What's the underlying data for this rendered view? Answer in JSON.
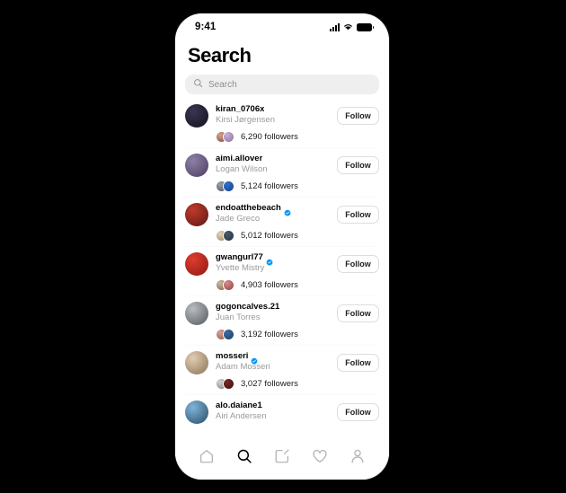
{
  "app": {
    "platform": "ios-instagram",
    "accent_verified": "#0095f6",
    "search_field_bg": "#efefef",
    "muted_text": "#9a9a9a"
  },
  "status_bar": {
    "time": "9:41",
    "icons": [
      "cellular-signal-icon",
      "wifi-icon",
      "battery-icon"
    ]
  },
  "header": {
    "title": "Search"
  },
  "search": {
    "icon": "search-icon",
    "value": "",
    "placeholder": "Search"
  },
  "results": [
    {
      "username": "kiran_0706x",
      "fullname": "Kirsi Jørgensen",
      "verified": false,
      "followers": "6,290 followers",
      "follow_label": "Follow",
      "avatar_colors": [
        "#3a3550",
        "#15121f"
      ],
      "mutual_colors": [
        [
          "#d9a28f",
          "#7a4a3a"
        ],
        [
          "#c8b2d6",
          "#8c6fa0"
        ]
      ]
    },
    {
      "username": "aimi.allover",
      "fullname": "Logan Wilson",
      "verified": false,
      "followers": "5,124 followers",
      "follow_label": "Follow",
      "avatar_colors": [
        "#8e7fa8",
        "#4a3f5c"
      ],
      "mutual_colors": [
        [
          "#9aa0a6",
          "#4e545a"
        ],
        [
          "#2f6fd0",
          "#17407f"
        ]
      ]
    },
    {
      "username": "endoatthebeach",
      "fullname": "Jade Greco",
      "verified": true,
      "followers": "5,012 followers",
      "follow_label": "Follow",
      "avatar_colors": [
        "#c0392b",
        "#5a1a14"
      ],
      "mutual_colors": [
        [
          "#e3d2b8",
          "#9c8560"
        ],
        [
          "#4a5a6a",
          "#243240"
        ]
      ]
    },
    {
      "username": "gwangurl77",
      "fullname": "Yvette Mistry",
      "verified": true,
      "followers": "4,903 followers",
      "follow_label": "Follow",
      "avatar_colors": [
        "#e03b2f",
        "#8c1a12"
      ],
      "mutual_colors": [
        [
          "#cdb79e",
          "#7a6450"
        ],
        [
          "#d98a8a",
          "#8f3f3f"
        ]
      ]
    },
    {
      "username": "gogoncalves.21",
      "fullname": "Juan Torres",
      "verified": false,
      "followers": "3,192 followers",
      "follow_label": "Follow",
      "avatar_colors": [
        "#b9bcc0",
        "#55585c"
      ],
      "mutual_colors": [
        [
          "#d8a090",
          "#8a5a4a"
        ],
        [
          "#3a6ea8",
          "#1c3c60"
        ]
      ]
    },
    {
      "username": "mosseri",
      "fullname": "Adam Mosseri",
      "verified": true,
      "followers": "3,027 followers",
      "follow_label": "Follow",
      "avatar_colors": [
        "#e0cdb4",
        "#8a7254"
      ],
      "mutual_colors": [
        [
          "#cfd4d8",
          "#7d8287"
        ],
        [
          "#7a2a22",
          "#3a110d"
        ]
      ]
    },
    {
      "username": "alo.daiane1",
      "fullname": "Airi Andersen",
      "verified": false,
      "followers": "",
      "follow_label": "Follow",
      "avatar_colors": [
        "#7fb4d8",
        "#2a4a66"
      ],
      "mutual_colors": []
    }
  ],
  "tabbar": {
    "items": [
      {
        "name": "home-icon",
        "active": false
      },
      {
        "name": "search-icon",
        "active": true
      },
      {
        "name": "create-icon",
        "active": false
      },
      {
        "name": "heart-icon",
        "active": false
      },
      {
        "name": "profile-icon",
        "active": false
      }
    ]
  }
}
